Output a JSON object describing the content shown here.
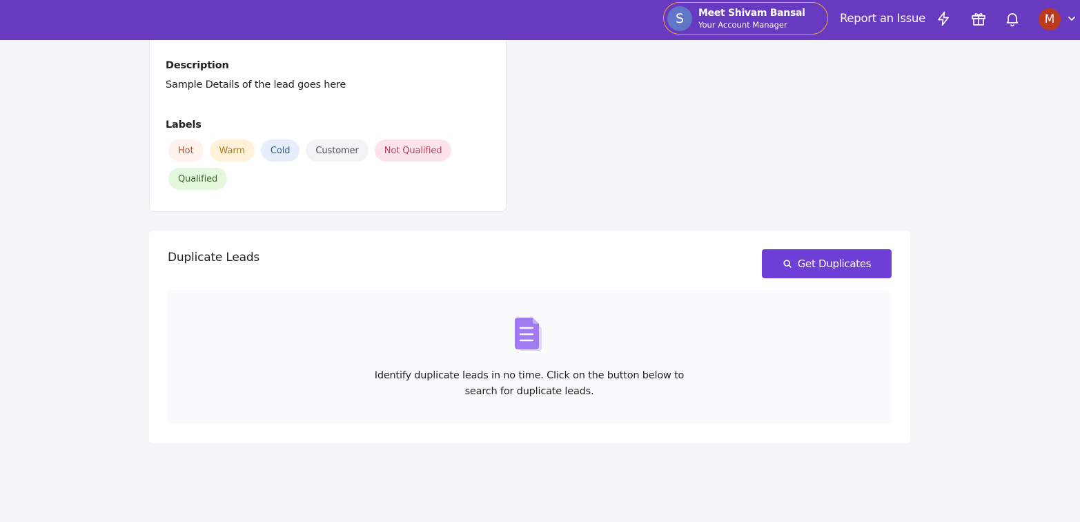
{
  "header": {
    "account_manager": {
      "initial": "S",
      "name": "Meet Shivam Bansal",
      "role": "Your Account Manager"
    },
    "report_issue": "Report an Issue",
    "icons": [
      "lightning-icon",
      "gift-icon",
      "bell-icon",
      "chevron-down-icon"
    ],
    "user_initial": "M",
    "colors": {
      "bar": "#673ac0",
      "pill_border": "#f0a640",
      "user_avatar": "#bb3a1e"
    }
  },
  "details": {
    "description_label": "Description",
    "description_text": "Sample Details of the lead goes here",
    "labels_label": "Labels",
    "labels": [
      {
        "text": "Hot",
        "bg": "#fff1ec",
        "color": "#b4553a"
      },
      {
        "text": "Warm",
        "bg": "#fff2d9",
        "color": "#b07a1f"
      },
      {
        "text": "Cold",
        "bg": "#e6eefc",
        "color": "#3e5a8e"
      },
      {
        "text": "Customer",
        "bg": "#f2f3f5",
        "color": "#4b4f5c"
      },
      {
        "text": "Not Qualified",
        "bg": "#fde4ea",
        "color": "#b0455d"
      },
      {
        "text": "Qualified",
        "bg": "#e3f8dd",
        "color": "#3d6b33"
      }
    ]
  },
  "duplicates": {
    "title": "Duplicate Leads",
    "button_label": "Get Duplicates",
    "empty_text_line1": "Identify duplicate leads in no time. Click on the button below to",
    "empty_text_line2": "search for duplicate leads.",
    "colors": {
      "button": "#6f3ed6",
      "doc_icon": "#a07bf2"
    }
  }
}
